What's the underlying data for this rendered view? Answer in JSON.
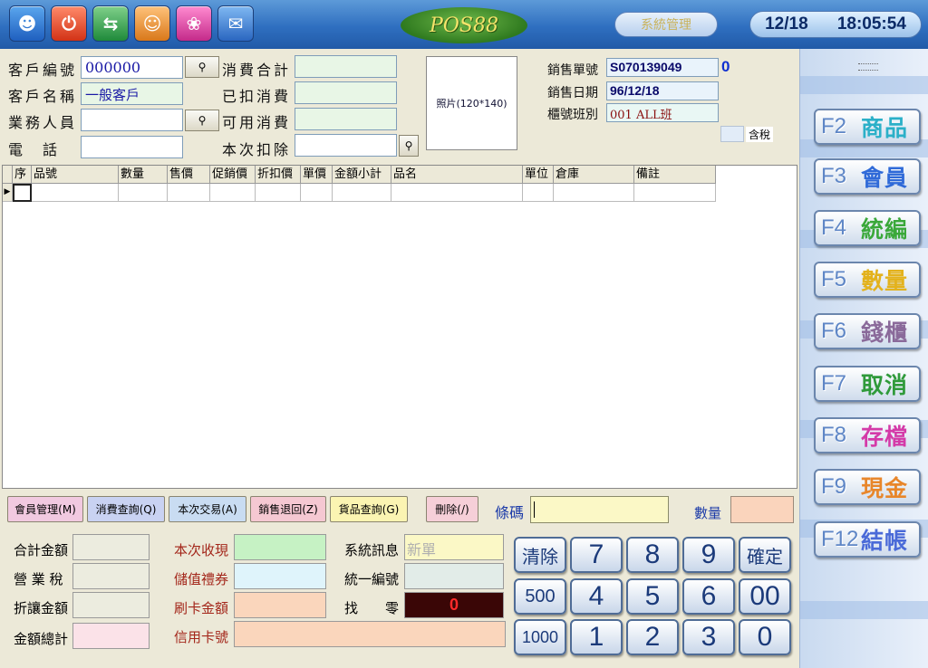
{
  "top": {
    "logo": "POS88",
    "system_button": "系統管理",
    "date": "12/18",
    "time": "18:05:54",
    "icons": [
      "user-icon",
      "power-icon",
      "exchange-icon",
      "members-icon",
      "flower-icon",
      "mail-icon"
    ],
    "icon_colors": [
      "#2d7bd8",
      "#e8452a",
      "#2ea84a",
      "#e79a2a",
      "#e24fa8",
      "#2d7bd8"
    ]
  },
  "customer": {
    "id_label": "客戶編號",
    "id_value": "000000",
    "name_label": "客戶名稱",
    "name_value": "一般客戶",
    "sales_label": "業務人員",
    "sales_value": "",
    "phone_label": "電　話",
    "phone_value": ""
  },
  "consume": {
    "total_label": "消費合計",
    "deducted_label": "已扣消費",
    "available_label": "可用消費",
    "this_label": "本次扣除"
  },
  "photo": {
    "label": "照片(120*140)"
  },
  "order": {
    "no_label": "銷售單號",
    "no_value": "S070139049",
    "count": "0",
    "date_label": "銷售日期",
    "date_value": "96/12/18",
    "shift_label": "櫃號班別",
    "shift_value": "001 ALL班",
    "tax_label": "含稅"
  },
  "grid": {
    "columns": [
      "序",
      "品號",
      "數量",
      "售價",
      "促銷價",
      "折扣價",
      "單價",
      "金額小計",
      "品名",
      "單位",
      "倉庫",
      "備註"
    ]
  },
  "actions": {
    "member_mgmt": "會員管理(M)",
    "consume_query": "消費查詢(Q)",
    "this_trade": "本次交易(A)",
    "sales_return": "銷售退回(Z)",
    "goods_query": "貨品查詢(G)",
    "delete": "刪除(/)",
    "barcode_label": "條碼",
    "qty_label": "數量"
  },
  "summary": {
    "total_label": "合計金額",
    "tax_label": "營 業 稅",
    "discount_label": "折讓金額",
    "grand_label": "金額總計",
    "received_label": "本次收現",
    "stored_label": "儲值禮券",
    "card_amount_label": "刷卡金額",
    "card_no_label": "信用卡號",
    "sysmsg_label": "系統訊息",
    "sysmsg_value": "新單",
    "unified_label": "統一編號",
    "change_label": "找　　零",
    "change_value": "0"
  },
  "keypad": {
    "clear": "清除",
    "k500": "500",
    "k1000": "1000",
    "ok": "確定",
    "k00": "00",
    "nums": [
      "7",
      "8",
      "9",
      "4",
      "5",
      "6",
      "1",
      "2",
      "3",
      "0"
    ]
  },
  "fkeys": [
    {
      "key": "F2",
      "label": "商品",
      "color": "#2bb0c8"
    },
    {
      "key": "F3",
      "label": "會員",
      "color": "#2f6ad8"
    },
    {
      "key": "F4",
      "label": "統編",
      "color": "#3aa83a"
    },
    {
      "key": "F5",
      "label": "數量",
      "color": "#e3b21c"
    },
    {
      "key": "F6",
      "label": "錢櫃",
      "color": "#8a6a9a"
    },
    {
      "key": "F7",
      "label": "取消",
      "color": "#2f9a3a"
    },
    {
      "key": "F8",
      "label": "存檔",
      "color": "#d43aa8"
    },
    {
      "key": "F9",
      "label": "現金",
      "color": "#e8862a"
    },
    {
      "key": "F12",
      "label": "結帳",
      "color": "#4a6ad8"
    }
  ]
}
